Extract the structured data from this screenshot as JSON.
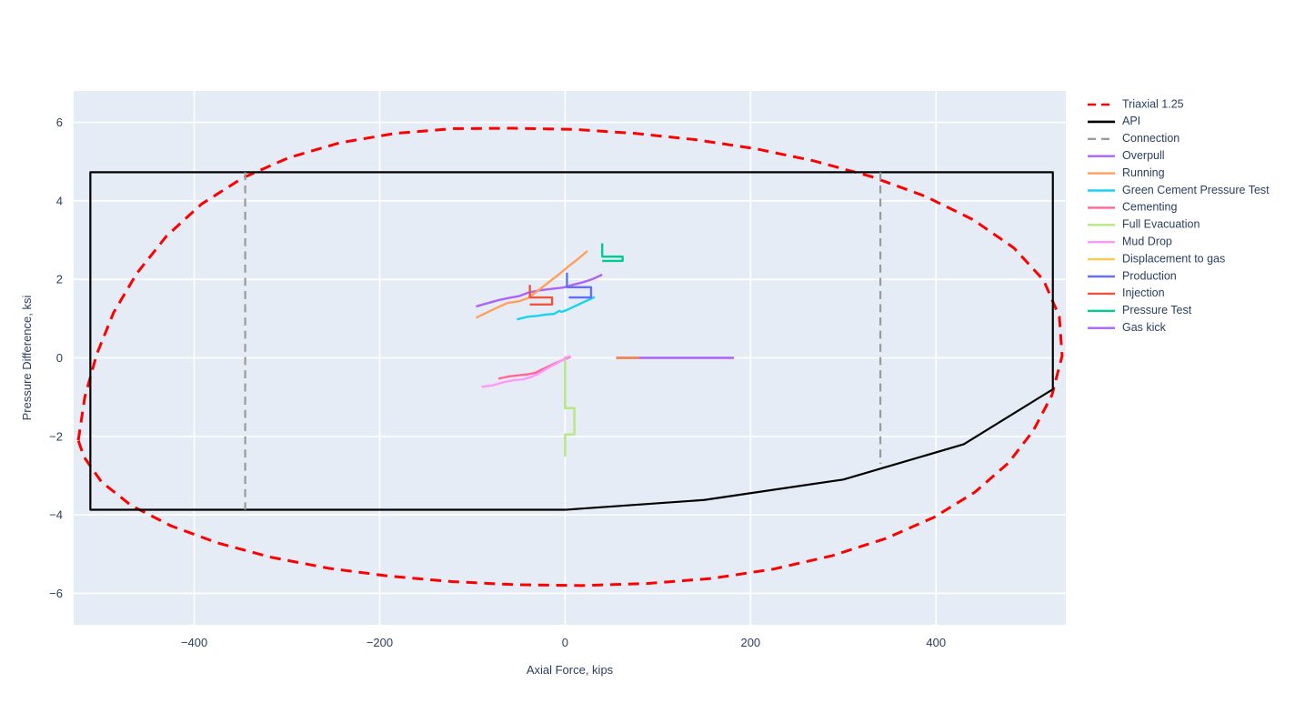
{
  "chart_data": {
    "type": "line",
    "title": "",
    "xlabel": "Axial Force, kips",
    "ylabel": "Pressure Difference, ksi",
    "xlim": [
      -530,
      540
    ],
    "ylim": [
      -6.8,
      6.8
    ],
    "xticks": [
      -400,
      -200,
      0,
      200,
      400
    ],
    "yticks": [
      -6,
      -4,
      -2,
      0,
      2,
      4,
      6
    ],
    "xtick_labels": [
      "−400",
      "−200",
      "0",
      "200",
      "400"
    ],
    "ytick_labels": [
      "−6",
      "−4",
      "−2",
      "0",
      "2",
      "4",
      "6"
    ],
    "grid": true,
    "plot_bgcolor": "#e5ecf6",
    "paper_bgcolor": "#ffffff",
    "gridcolor": "#ffffff",
    "legend_position": "right",
    "series": [
      {
        "name": "Triaxial 1.25",
        "color": "#ff0000",
        "dash": "dash",
        "width": 3,
        "closed": true,
        "points": [
          [
            -525,
            -2.1
          ],
          [
            -518,
            -1.0
          ],
          [
            -505,
            0.1
          ],
          [
            -487,
            1.15
          ],
          [
            -462,
            2.15
          ],
          [
            -430,
            3.1
          ],
          [
            -392,
            3.92
          ],
          [
            -348,
            4.58
          ],
          [
            -298,
            5.1
          ],
          [
            -243,
            5.48
          ],
          [
            -183,
            5.72
          ],
          [
            -120,
            5.84
          ],
          [
            -55,
            5.85
          ],
          [
            10,
            5.82
          ],
          [
            75,
            5.72
          ],
          [
            140,
            5.56
          ],
          [
            205,
            5.33
          ],
          [
            268,
            5.02
          ],
          [
            330,
            4.62
          ],
          [
            388,
            4.12
          ],
          [
            440,
            3.52
          ],
          [
            484,
            2.8
          ],
          [
            516,
            1.98
          ],
          [
            533,
            1.05
          ],
          [
            536,
            0.05
          ],
          [
            525,
            -0.95
          ],
          [
            505,
            -1.85
          ],
          [
            478,
            -2.68
          ],
          [
            442,
            -3.42
          ],
          [
            398,
            -4.06
          ],
          [
            346,
            -4.6
          ],
          [
            288,
            -5.04
          ],
          [
            225,
            -5.38
          ],
          [
            158,
            -5.62
          ],
          [
            88,
            -5.75
          ],
          [
            18,
            -5.8
          ],
          [
            -52,
            -5.78
          ],
          [
            -122,
            -5.7
          ],
          [
            -190,
            -5.56
          ],
          [
            -255,
            -5.36
          ],
          [
            -317,
            -5.08
          ],
          [
            -374,
            -4.72
          ],
          [
            -425,
            -4.28
          ],
          [
            -468,
            -3.76
          ],
          [
            -500,
            -3.16
          ],
          [
            -519,
            -2.52
          ]
        ]
      },
      {
        "name": "API",
        "color": "#000000",
        "dash": "solid",
        "width": 2.2,
        "closed": true,
        "points": [
          [
            -512,
            4.73
          ],
          [
            526,
            4.73
          ],
          [
            526,
            -0.8
          ],
          [
            430,
            -2.2
          ],
          [
            300,
            -3.1
          ],
          [
            150,
            -3.62
          ],
          [
            0,
            -3.87
          ],
          [
            -512,
            -3.87
          ]
        ]
      },
      {
        "name": "Connection",
        "color": "#9a9a9a",
        "dash": "dash",
        "width": 2.2,
        "segments": [
          [
            [
              -345,
              4.73
            ],
            [
              -345,
              -3.87
            ]
          ],
          [
            [
              340,
              4.73
            ],
            [
              340,
              -2.7
            ]
          ]
        ]
      },
      {
        "name": "Overpull",
        "color": "#ab63fa",
        "dash": "solid",
        "width": 2.4,
        "points": [
          [
            -96,
            1.31
          ],
          [
            -72,
            1.47
          ],
          [
            -58,
            1.54
          ],
          [
            -50,
            1.57
          ],
          [
            -40,
            1.66
          ],
          [
            -28,
            1.72
          ],
          [
            -14,
            1.76
          ],
          [
            -2,
            1.79
          ],
          [
            8,
            1.86
          ],
          [
            20,
            1.93
          ],
          [
            30,
            2.01
          ],
          [
            40,
            2.12
          ]
        ]
      },
      {
        "name": "Running",
        "color": "#ffa15a",
        "dash": "solid",
        "width": 2.4,
        "points": [
          [
            -96,
            1.02
          ],
          [
            -76,
            1.25
          ],
          [
            -62,
            1.4
          ],
          [
            -50,
            1.44
          ],
          [
            -40,
            1.52
          ],
          [
            -30,
            1.7
          ],
          [
            -18,
            1.92
          ],
          [
            -6,
            2.14
          ],
          [
            4,
            2.34
          ],
          [
            14,
            2.52
          ],
          [
            24,
            2.72
          ]
        ]
      },
      {
        "name": "Green Cement Pressure Test",
        "color": "#19d3f3",
        "dash": "solid",
        "width": 2.4,
        "points": [
          [
            -52,
            0.98
          ],
          [
            -40,
            1.05
          ],
          [
            -30,
            1.07
          ],
          [
            -22,
            1.1
          ],
          [
            -12,
            1.12
          ],
          [
            -6,
            1.2
          ],
          [
            -4,
            1.17
          ],
          [
            2,
            1.22
          ],
          [
            10,
            1.31
          ],
          [
            20,
            1.42
          ],
          [
            32,
            1.55
          ]
        ]
      },
      {
        "name": "Cementing",
        "color": "#ff6692",
        "dash": "solid",
        "width": 2.4,
        "points": [
          [
            -72,
            -0.53
          ],
          [
            -60,
            -0.47
          ],
          [
            -48,
            -0.44
          ],
          [
            -40,
            -0.42
          ],
          [
            -32,
            -0.38
          ],
          [
            -26,
            -0.31
          ],
          [
            -18,
            -0.22
          ],
          [
            -10,
            -0.13
          ],
          [
            -2,
            -0.05
          ],
          [
            6,
            0.03
          ]
        ]
      },
      {
        "name": "Full Evacuation",
        "color": "#b6e880",
        "dash": "solid",
        "width": 2.4,
        "points": [
          [
            0,
            0.04
          ],
          [
            0,
            -1.28
          ],
          [
            10,
            -1.28
          ],
          [
            10,
            -1.95
          ],
          [
            0,
            -1.95
          ],
          [
            0,
            -2.52
          ]
        ]
      },
      {
        "name": "Mud Drop",
        "color": "#ff97ff",
        "dash": "solid",
        "width": 2.4,
        "points": [
          [
            -90,
            -0.74
          ],
          [
            -78,
            -0.7
          ],
          [
            -66,
            -0.62
          ],
          [
            -56,
            -0.57
          ],
          [
            -46,
            -0.55
          ],
          [
            -38,
            -0.5
          ],
          [
            -30,
            -0.42
          ],
          [
            -22,
            -0.31
          ],
          [
            -14,
            -0.2
          ],
          [
            -6,
            -0.1
          ],
          [
            2,
            0.02
          ],
          [
            6,
            0.05
          ]
        ]
      },
      {
        "name": "Displacement to gas",
        "color": "#fecb52",
        "dash": "solid",
        "width": 3.0,
        "points": [
          [
            55,
            0.0
          ],
          [
            80,
            0.0
          ]
        ],
        "overlay_color": "#ef8b5e"
      },
      {
        "name": "Production",
        "color": "#636efa",
        "dash": "solid",
        "width": 2.4,
        "points": [
          [
            2,
            2.17
          ],
          [
            2,
            1.8
          ],
          [
            28,
            1.8
          ],
          [
            28,
            1.54
          ],
          [
            4,
            1.54
          ]
        ]
      },
      {
        "name": "Injection",
        "color": "#ef553b",
        "dash": "solid",
        "width": 2.4,
        "points": [
          [
            -38,
            1.86
          ],
          [
            -38,
            1.54
          ],
          [
            -14,
            1.54
          ],
          [
            -14,
            1.36
          ],
          [
            -38,
            1.36
          ]
        ]
      },
      {
        "name": "Pressure Test",
        "color": "#00cc96",
        "dash": "solid",
        "width": 2.4,
        "points": [
          [
            40,
            2.92
          ],
          [
            40,
            2.58
          ],
          [
            62,
            2.58
          ],
          [
            62,
            2.47
          ],
          [
            40,
            2.47
          ]
        ]
      },
      {
        "name": "Gas kick",
        "color": "#ab63fa",
        "dash": "solid",
        "width": 2.6,
        "points": [
          [
            80,
            0.0
          ],
          [
            182,
            0.0
          ]
        ]
      }
    ]
  },
  "legend": {
    "items": [
      {
        "label": "Triaxial 1.25",
        "color": "#ff0000",
        "dash": "dash"
      },
      {
        "label": "API",
        "color": "#000000",
        "dash": "solid"
      },
      {
        "label": "Connection",
        "color": "#9a9a9a",
        "dash": "dash"
      },
      {
        "label": "Overpull",
        "color": "#ab63fa",
        "dash": "solid"
      },
      {
        "label": "Running",
        "color": "#ffa15a",
        "dash": "solid"
      },
      {
        "label": "Green Cement Pressure Test",
        "color": "#19d3f3",
        "dash": "solid"
      },
      {
        "label": "Cementing",
        "color": "#ff6692",
        "dash": "solid"
      },
      {
        "label": "Full Evacuation",
        "color": "#b6e880",
        "dash": "solid"
      },
      {
        "label": "Mud Drop",
        "color": "#ff97ff",
        "dash": "solid"
      },
      {
        "label": "Displacement to gas",
        "color": "#fecb52",
        "dash": "solid"
      },
      {
        "label": "Production",
        "color": "#636efa",
        "dash": "solid"
      },
      {
        "label": "Injection",
        "color": "#ef553b",
        "dash": "solid"
      },
      {
        "label": "Pressure Test",
        "color": "#00cc96",
        "dash": "solid"
      },
      {
        "label": "Gas kick",
        "color": "#ab63fa",
        "dash": "solid"
      }
    ]
  }
}
